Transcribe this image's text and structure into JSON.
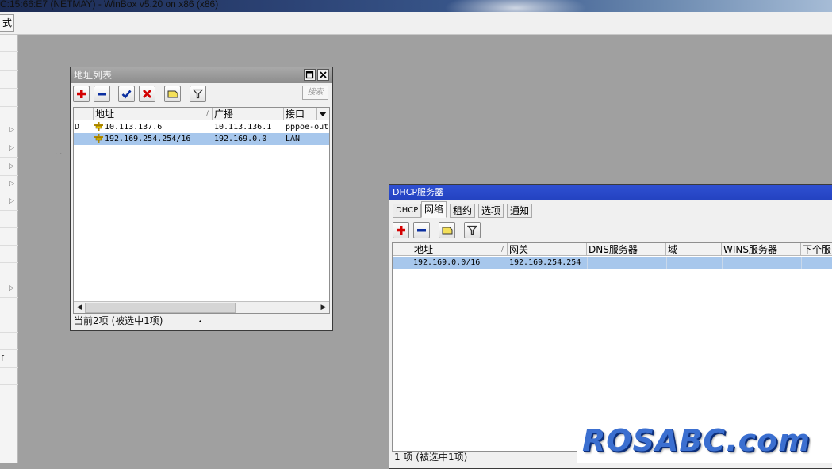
{
  "app": {
    "title": "C:15:66:E7 (NETMAY) - WinBox v5.20 on x86 (x86)",
    "toolbar_button": "式",
    "left_menu_text_1": "f"
  },
  "address_window": {
    "title": "地址列表",
    "search_placeholder": "搜索",
    "columns": [
      "地址",
      "广播",
      "接口"
    ],
    "rows": [
      {
        "flag": "D",
        "address": "10.113.137.6",
        "broadcast": "10.113.136.1",
        "interface": "pppoe-out"
      },
      {
        "flag": "",
        "address": "192.169.254.254/16",
        "broadcast": "192.169.0.0",
        "interface": "LAN"
      }
    ],
    "selected_row": 1,
    "status": "当前2项 (被选中1项)"
  },
  "dhcp_window": {
    "title": "DHCP服务器",
    "tabs": [
      "DHCP",
      "网络",
      "租约",
      "选项",
      "通知"
    ],
    "active_tab": 1,
    "columns": [
      "地址",
      "网关",
      "DNS服务器",
      "域",
      "WINS服务器",
      "下个服"
    ],
    "rows": [
      {
        "address": "192.169.0.0/16",
        "gateway": "192.169.254.254",
        "dns": "",
        "domain": "",
        "wins": "",
        "next": ""
      }
    ],
    "status": "1 项 (被选中1项)"
  },
  "watermark": "ROSABC.com",
  "icons": {
    "add": "plus-icon",
    "remove": "minus-icon",
    "enable": "check-icon",
    "disable": "cross-icon",
    "comment": "note-icon",
    "filter": "filter-icon",
    "restore": "restore-icon",
    "close": "close-icon",
    "address_row": "ip-address-icon"
  },
  "colors": {
    "dhcp_titlebar": "#2342c0",
    "address_titlebar": "#8d8d8d",
    "selection": "#a7c7ec",
    "add_icon": "#d30000",
    "remove_icon": "#0b2fa0",
    "workspace": "#a0a0a0"
  }
}
